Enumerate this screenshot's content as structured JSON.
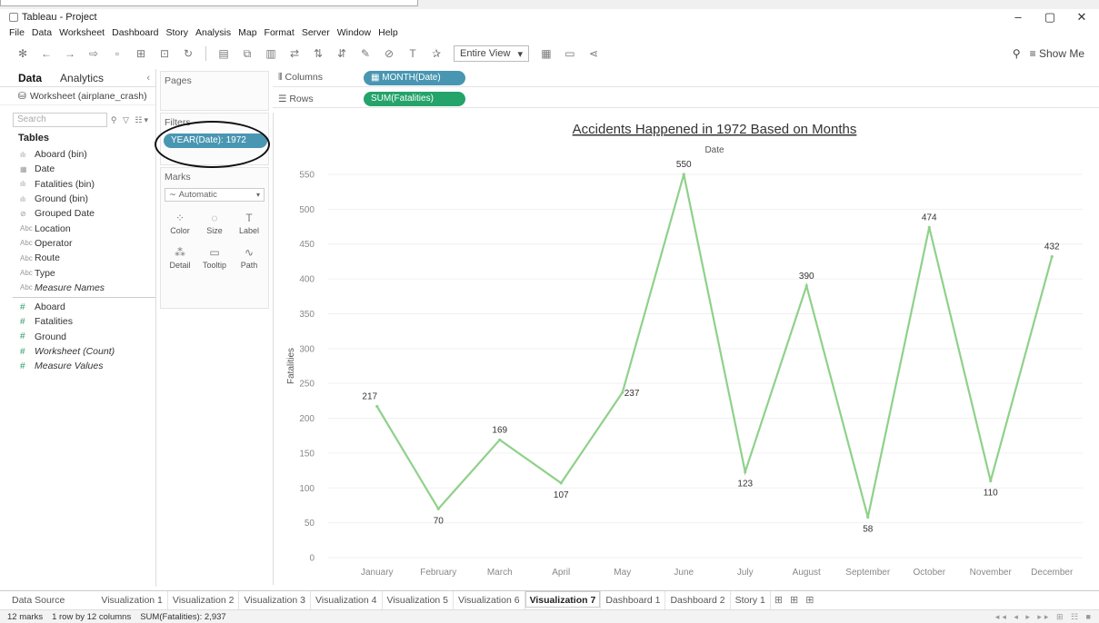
{
  "window": {
    "title": "Tableau - Project",
    "controls": [
      "–",
      "▢",
      "✕"
    ]
  },
  "menu": [
    "File",
    "Data",
    "Worksheet",
    "Dashboard",
    "Story",
    "Analysis",
    "Map",
    "Format",
    "Server",
    "Window",
    "Help"
  ],
  "toolbar": {
    "view_mode": "Entire View",
    "show_me": "Show Me"
  },
  "left_pane": {
    "tab_data": "Data",
    "tab_analytics": "Analytics",
    "data_source": "Worksheet (airplane_crash)",
    "search_placeholder": "Search",
    "tables_header": "Tables",
    "dimensions": [
      {
        "icon": "bin-icon",
        "glyph": "ılı",
        "label": "Aboard (bin)"
      },
      {
        "icon": "calendar-icon",
        "glyph": "▦",
        "label": "Date"
      },
      {
        "icon": "bin-icon",
        "glyph": "ılı",
        "label": "Fatalities (bin)"
      },
      {
        "icon": "bin-icon",
        "glyph": "ılı",
        "label": "Ground (bin)"
      },
      {
        "icon": "clip-icon",
        "glyph": "⊘",
        "label": "Grouped Date"
      },
      {
        "icon": "abc-icon",
        "glyph": "Abc",
        "label": "Location"
      },
      {
        "icon": "abc-icon",
        "glyph": "Abc",
        "label": "Operator"
      },
      {
        "icon": "abc-icon",
        "glyph": "Abc",
        "label": "Route"
      },
      {
        "icon": "abc-icon",
        "glyph": "Abc",
        "label": "Type"
      },
      {
        "icon": "abc-icon",
        "glyph": "Abc",
        "label": "Measure Names"
      }
    ],
    "measures": [
      {
        "label": "Aboard"
      },
      {
        "label": "Fatalities"
      },
      {
        "label": "Ground"
      },
      {
        "label": "Worksheet (Count)"
      },
      {
        "label": "Measure Values"
      }
    ]
  },
  "cards": {
    "pages": "Pages",
    "filters": "Filters",
    "filter_pill": "YEAR(Date): 1972",
    "marks": "Marks",
    "marks_type": "Automatic",
    "mark_buttons": [
      {
        "icon": "color-icon",
        "glyph": "⁘",
        "label": "Color"
      },
      {
        "icon": "size-icon",
        "glyph": "◌",
        "label": "Size"
      },
      {
        "icon": "label-icon",
        "glyph": "T",
        "label": "Label"
      },
      {
        "icon": "detail-icon",
        "glyph": "⁂",
        "label": "Detail"
      },
      {
        "icon": "tooltip-icon",
        "glyph": "▭",
        "label": "Tooltip"
      },
      {
        "icon": "path-icon",
        "glyph": "∿",
        "label": "Path"
      }
    ]
  },
  "shelves": {
    "columns_label": "Columns",
    "columns_pill": "MONTH(Date)",
    "rows_label": "Rows",
    "rows_pill": "SUM(Fatalities)"
  },
  "chart_data": {
    "type": "line",
    "title": "Accidents Happened in 1972 Based on Months",
    "xlabel": "Date",
    "ylabel": "Fatalities",
    "categories": [
      "January",
      "February",
      "March",
      "April",
      "May",
      "June",
      "July",
      "August",
      "September",
      "October",
      "November",
      "December"
    ],
    "values": [
      217,
      70,
      169,
      107,
      237,
      550,
      123,
      390,
      58,
      474,
      110,
      432
    ],
    "ylim": [
      0,
      550
    ],
    "yticks": [
      0,
      50,
      100,
      150,
      200,
      250,
      300,
      350,
      400,
      450,
      500,
      550
    ],
    "line_color": "#8fd18a",
    "grid": true,
    "label_positions": [
      "above",
      "below",
      "above",
      "below",
      "right",
      "above",
      "below",
      "above",
      "below",
      "above",
      "below",
      "above"
    ]
  },
  "sheet_tabs": {
    "data_source": "Data Source",
    "sheets": [
      "Visualization 1",
      "Visualization 2",
      "Visualization 3",
      "Visualization 4",
      "Visualization 5",
      "Visualization 6",
      "Visualization 7",
      "Dashboard 1",
      "Dashboard 2",
      "Story 1"
    ],
    "active": "Visualization 7"
  },
  "status": {
    "marks": "12 marks",
    "dims": "1 row by 12 columns",
    "sum": "SUM(Fatalities): 2,937"
  }
}
